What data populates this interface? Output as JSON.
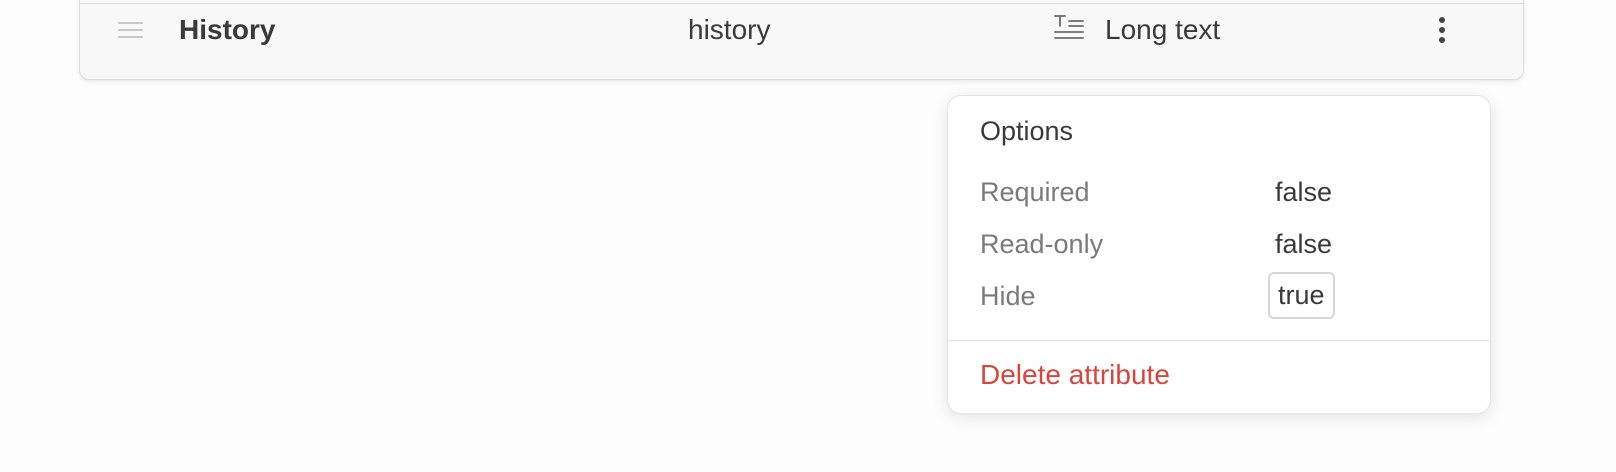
{
  "attribute_row": {
    "name": "History",
    "key": "history",
    "type_label": "Long text",
    "type_icon": "long-text-icon",
    "menu_icon": "more-vertical-icon",
    "drag_icon": "drag-handle-icon"
  },
  "options_menu": {
    "title": "Options",
    "items": [
      {
        "label": "Required",
        "value": "false"
      },
      {
        "label": "Read-only",
        "value": "false"
      },
      {
        "label": "Hide",
        "value": "true"
      }
    ],
    "delete_label": "Delete attribute",
    "delete_color": "#d9453d"
  }
}
